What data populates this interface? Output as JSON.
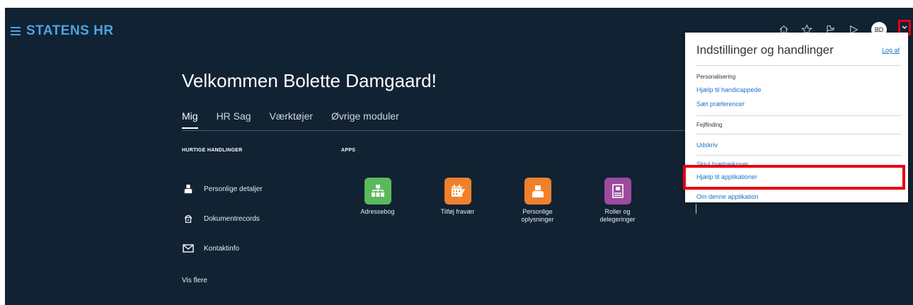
{
  "header": {
    "brand": "STATENS HR",
    "icons": [
      "home-icon",
      "star-icon",
      "flag-icon",
      "play-icon"
    ],
    "avatar_initials": "BD"
  },
  "welcome": {
    "title": "Velkommen Bolette Damgaard!"
  },
  "tabs": [
    {
      "label": "Mig",
      "active": true
    },
    {
      "label": "HR Sag"
    },
    {
      "label": "Værktøjer"
    },
    {
      "label": "Øvrige moduler"
    }
  ],
  "quick_actions": {
    "title": "HURTIGE HANDLINGER",
    "items": [
      {
        "label": "Personlige detaljer",
        "icon": "person-icon"
      },
      {
        "label": "Dokumentrecords",
        "icon": "documents-icon"
      },
      {
        "label": "Kontaktinfo",
        "icon": "mail-icon"
      }
    ],
    "more": "Vis flere"
  },
  "apps": {
    "title": "APPS",
    "items": [
      {
        "label": "Adressebog",
        "color": "#5cb85c",
        "icon": "org-chart-icon"
      },
      {
        "label": "Tilføj fravær",
        "color": "#f0802c",
        "icon": "calendar-icon"
      },
      {
        "label": "Personlige oplysninger",
        "color": "#f0802c",
        "icon": "person-icon"
      },
      {
        "label": "Roller og delegeringer",
        "color": "#9c4b9d",
        "icon": "badge-icon"
      }
    ]
  },
  "settings_panel": {
    "title": "Indstillinger og handlinger",
    "logout": "Log af",
    "personalization_heading": "Personalisering",
    "accessibility_link": "Hjælp til handicappede",
    "preferences_link": "Sæt præferencer",
    "troubleshooting_heading": "Fejlfinding",
    "print_link": "Udskriv",
    "hide_help_icons_link": "Skjul hjælpeikoner",
    "app_help_link": "Hjælp til applikationer",
    "about_link": "Om denne applikation"
  },
  "colors": {
    "background": "#112233",
    "brand": "#4da3e0",
    "link": "#1a73c8",
    "highlight": "#e60012"
  }
}
